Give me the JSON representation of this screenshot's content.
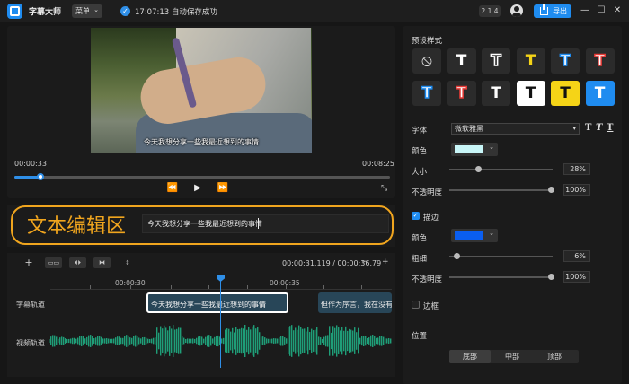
{
  "app": {
    "title": "字幕大师",
    "menu_label": "菜单",
    "save_status": "17:07:13 自动保存成功",
    "version": "2.1.4",
    "export_label": "导出",
    "window_controls": [
      "—",
      "☐",
      "✕"
    ]
  },
  "player": {
    "subtitle": "今天我想分享一些我最近想到的事情",
    "time_current": "00:00:33",
    "time_total": "00:08:25",
    "progress": 0.07,
    "controls": [
      "⏪",
      "▶",
      "⏩"
    ],
    "fullscreen_icon": "⤡"
  },
  "text_edit": {
    "label": "文本编辑区",
    "value": "今天我想分享一些我最近想到的事情"
  },
  "timeline": {
    "tools": [
      "+",
      "▭▭",
      "⏴⏵",
      "⏵⏴",
      "⇕"
    ],
    "current_time": "00:00:31.119",
    "separator": "/",
    "total_time": "00:00:36.79",
    "zoom_out": "−",
    "zoom_in": "+",
    "ticks": [
      "00:00:30",
      "00:00:35"
    ],
    "subtitle_track_label": "字幕轨道",
    "video_track_label": "视频轨道",
    "clips": [
      {
        "text": "今天我想分享一些我最近想到的事情"
      },
      {
        "text": "但作为序言，我在没有"
      }
    ]
  },
  "style_panel": {
    "preset_title": "预设样式",
    "presets": [
      {
        "glyph": "⃠",
        "fg": "#dddddd",
        "bg": "#2b2b2b",
        "name": "none"
      },
      {
        "glyph": "T",
        "fg": "#ffffff",
        "bg": "#2b2b2b",
        "name": "white"
      },
      {
        "glyph": "T",
        "fg": "#2b2b2b",
        "bg": "#2b2b2b",
        "stroke": "#ffffff",
        "name": "outline-white"
      },
      {
        "glyph": "T",
        "fg": "#f5d417",
        "bg": "#2b2b2b",
        "name": "yellow"
      },
      {
        "glyph": "T",
        "fg": "#ffffff",
        "bg": "#2b2b2b",
        "stroke": "#1f8cf0",
        "name": "blue-stroke"
      },
      {
        "glyph": "T",
        "fg": "#ffffff",
        "bg": "#2b2b2b",
        "stroke": "#e53935",
        "name": "red-stroke"
      },
      {
        "glyph": "T",
        "fg": "#ffffff",
        "bg": "#2b2b2b",
        "stroke": "#1f8cf0",
        "name": "blue-stroke-2"
      },
      {
        "glyph": "T",
        "fg": "#ffffff",
        "bg": "#2b2b2b",
        "stroke": "#e53935",
        "name": "red-stroke-2"
      },
      {
        "glyph": "T",
        "fg": "#ffffff",
        "bg": "#2b2b2b",
        "name": "white-2"
      },
      {
        "glyph": "T",
        "fg": "#111111",
        "bg": "#ffffff",
        "name": "black-on-white"
      },
      {
        "glyph": "T",
        "fg": "#111111",
        "bg": "#f5d417",
        "name": "black-on-yellow"
      },
      {
        "glyph": "T",
        "fg": "#ffffff",
        "bg": "#1f8cf0",
        "name": "white-on-blue"
      }
    ],
    "font_label": "字体",
    "font_value": "微软雅黑",
    "font_styles": [
      "T",
      "T",
      "T"
    ],
    "color_label": "颜色",
    "text_color": "#c8f6f8",
    "size_label": "大小",
    "size_value": "28%",
    "size_level": 0.28,
    "opacity_label": "不透明度",
    "opacity_value": "100%",
    "opacity_level": 1.0,
    "stroke_label": "描边",
    "stroke_checked": true,
    "stroke_color_label": "颜色",
    "stroke_color": "#0a5ef0",
    "stroke_width_label": "粗细",
    "stroke_width_value": "6%",
    "stroke_width_level": 0.06,
    "stroke_opacity_label": "不透明度",
    "stroke_opacity_value": "100%",
    "stroke_opacity_level": 1.0,
    "border_label": "边框",
    "border_checked": false,
    "position_label": "位置",
    "positions": [
      "底部",
      "中部",
      "顶部"
    ],
    "position_selected": 0
  }
}
